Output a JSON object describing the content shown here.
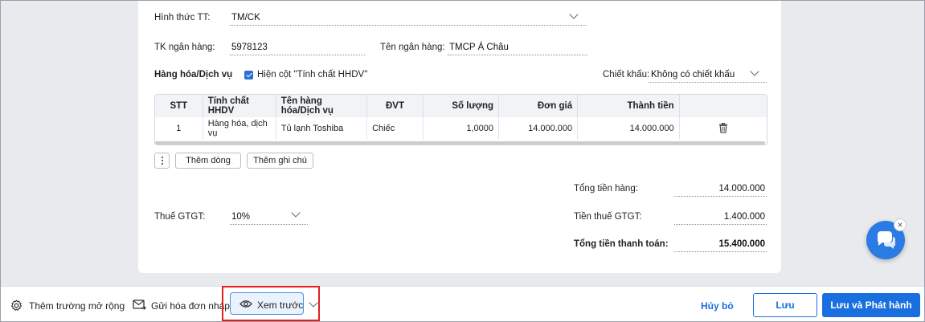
{
  "form": {
    "payment_method_label": "Hình thức TT:",
    "payment_method_value": "TM/CK",
    "bank_account_label": "TK ngân hàng:",
    "bank_account_value": "5978123",
    "bank_name_label": "Tên ngân hàng:",
    "bank_name_value": "TMCP Á Châu",
    "goods_section_label": "Hàng hóa/Dịch vụ",
    "show_column_label": "Hiện cột \"Tính chất HHDV\"",
    "discount_label": "Chiết khấu:",
    "discount_value": "Không có chiết khấu"
  },
  "table": {
    "headers": [
      "STT",
      "Tính chất HHDV",
      "Tên hàng hóa/Dịch vụ",
      "ĐVT",
      "Số lượng",
      "Đơn giá",
      "Thành tiền"
    ],
    "rows": [
      [
        "1",
        "Hàng hóa, dịch vụ",
        "Tủ lạnh Toshiba",
        "Chiếc",
        "1,0000",
        "14.000.000",
        "14.000.000"
      ]
    ]
  },
  "table_actions": {
    "add_row": "Thêm dòng",
    "add_note": "Thêm ghi chú"
  },
  "totals": {
    "goods_total_label": "Tổng tiền hàng:",
    "goods_total_value": "14.000.000",
    "vat_label": "Thuế GTGT:",
    "vat_value": "10%",
    "vat_amount_label": "Tiền thuế GTGT:",
    "vat_amount_value": "1.400.000",
    "grand_total_label": "Tổng tiền thanh toán:",
    "grand_total_value": "15.400.000"
  },
  "footer": {
    "extend_fields": "Thêm trường mở rộng",
    "send_draft": "Gửi hóa đơn nháp",
    "preview": "Xem trước",
    "cancel": "Hủy bỏ",
    "save": "Lưu",
    "save_issue": "Lưu và Phát hành"
  },
  "colors": {
    "primary": "#1a6fe0",
    "highlight_border": "#e02020"
  },
  "icons": [
    "gear-icon",
    "mail-send-icon",
    "eye-icon",
    "chevron-down-icon",
    "trash-icon",
    "chat-icon",
    "close-icon",
    "more-vertical-icon",
    "checkbox-checked-icon"
  ]
}
